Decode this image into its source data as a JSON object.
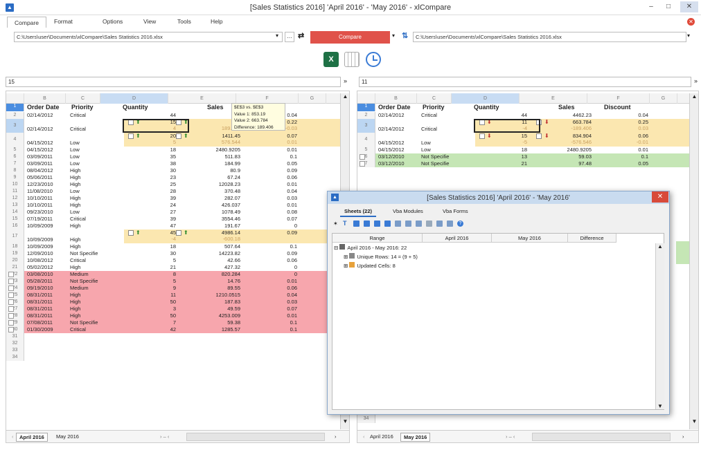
{
  "window": {
    "title": "[Sales Statistics 2016] 'April 2016' - 'May 2016' - xlCompare"
  },
  "menu": [
    "Compare",
    "Format",
    "Options",
    "View",
    "Tools",
    "Help"
  ],
  "paths": {
    "left": "C:\\Users\\user\\Documents\\xlCompare\\Sales Statistics 2016.xlsx",
    "right": "C:\\Users\\user\\Documents\\xlCompare\\Sales Statistics 2016.xlsx"
  },
  "compare_label": "Compare",
  "formula": {
    "left": "15",
    "right": "11"
  },
  "columns": [
    "B",
    "C",
    "D",
    "E",
    "F",
    "G"
  ],
  "header": {
    "order_date": "Order Date",
    "priority": "Priority",
    "quantity": "Quantity",
    "sales": "Sales",
    "discount": "Discount",
    "disc_trunc": "nt"
  },
  "tooltip": [
    "$E$3 vs. $E$3",
    "Value 1: 853.19",
    "Value 2: 663.784",
    "Difference: 189.406"
  ],
  "left_rows": [
    {
      "n": "2",
      "date": "02/14/2012",
      "pri": "Critical",
      "qty": "44",
      "sales": "446",
      "disc": "0.04"
    },
    {
      "n": "3",
      "date": "02/14/2012",
      "pri": "Critical",
      "qty": "15",
      "sub": "4",
      "sales": "85",
      "ssub": "189.406",
      "disc": "0.22",
      "dsub": "-0.03"
    },
    {
      "n": "4",
      "date": "04/15/2012",
      "pri": "Low",
      "qty": "20",
      "sub": "5",
      "sales": "1411.45",
      "ssub": "576.544",
      "disc": "0.07",
      "dsub": "0.01"
    },
    {
      "n": "5",
      "date": "04/15/2012",
      "pri": "Low",
      "qty": "18",
      "sales": "2480.9205",
      "disc": "0.01"
    },
    {
      "n": "6",
      "date": "03/09/2011",
      "pri": "Low",
      "qty": "35",
      "sales": "511.83",
      "disc": "0.1"
    },
    {
      "n": "7",
      "date": "03/09/2011",
      "pri": "Low",
      "qty": "38",
      "sales": "184.99",
      "disc": "0.05"
    },
    {
      "n": "8",
      "date": "08/04/2012",
      "pri": "High",
      "qty": "30",
      "sales": "80.9",
      "disc": "0.09"
    },
    {
      "n": "9",
      "date": "05/06/2011",
      "pri": "High",
      "qty": "23",
      "sales": "67.24",
      "disc": "0.06"
    },
    {
      "n": "10",
      "date": "12/23/2010",
      "pri": "High",
      "qty": "25",
      "sales": "12028.23",
      "disc": "0.01"
    },
    {
      "n": "11",
      "date": "11/08/2010",
      "pri": "Low",
      "qty": "28",
      "sales": "370.48",
      "disc": "0.04"
    },
    {
      "n": "12",
      "date": "10/10/2011",
      "pri": "High",
      "qty": "39",
      "sales": "282.07",
      "disc": "0.03"
    },
    {
      "n": "13",
      "date": "10/10/2011",
      "pri": "High",
      "qty": "24",
      "sales": "426.037",
      "disc": "0.01"
    },
    {
      "n": "14",
      "date": "09/23/2010",
      "pri": "Low",
      "qty": "27",
      "sales": "1078.49",
      "disc": "0.08"
    },
    {
      "n": "15",
      "date": "07/19/2011",
      "pri": "Critical",
      "qty": "39",
      "sales": "3554.46",
      "disc": "0.07"
    },
    {
      "n": "16",
      "date": "10/09/2009",
      "pri": "High",
      "qty": "47",
      "sales": "191.67",
      "disc": "0"
    },
    {
      "n": "17",
      "date": "10/09/2009",
      "pri": "High",
      "qty": "45",
      "sub": "-4",
      "sales": "4986.14",
      "ssub": "-600.18",
      "disc": "0.09"
    },
    {
      "n": "18",
      "date": "10/09/2009",
      "pri": "High",
      "qty": "18",
      "sales": "507.64",
      "disc": "0.1"
    },
    {
      "n": "19",
      "date": "12/09/2010",
      "pri": "Not Specifie",
      "qty": "30",
      "sales": "14223.82",
      "disc": "0.09"
    },
    {
      "n": "20",
      "date": "10/08/2012",
      "pri": "Critical",
      "qty": "5",
      "sales": "42.66",
      "disc": "0.06"
    },
    {
      "n": "21",
      "date": "05/02/2012",
      "pri": "High",
      "qty": "21",
      "sales": "427.32",
      "disc": "0"
    },
    {
      "n": "22",
      "date": "03/08/2010",
      "pri": "Medium",
      "qty": "8",
      "sales": "820.284",
      "disc": "0"
    },
    {
      "n": "23",
      "date": "05/28/2011",
      "pri": "Not Specifie",
      "qty": "5",
      "sales": "14.76",
      "disc": "0.01"
    },
    {
      "n": "24",
      "date": "09/19/2010",
      "pri": "Medium",
      "qty": "9",
      "sales": "89.55",
      "disc": "0.06"
    },
    {
      "n": "25",
      "date": "08/31/2011",
      "pri": "High",
      "qty": "11",
      "sales": "1210.0515",
      "disc": "0.04"
    },
    {
      "n": "26",
      "date": "08/31/2011",
      "pri": "High",
      "qty": "50",
      "sales": "187.83",
      "disc": "0.03"
    },
    {
      "n": "27",
      "date": "08/31/2011",
      "pri": "High",
      "qty": "3",
      "sales": "49.59",
      "disc": "0.07"
    },
    {
      "n": "28",
      "date": "08/31/2011",
      "pri": "High",
      "qty": "50",
      "sales": "4253.009",
      "disc": "0.01"
    },
    {
      "n": "29",
      "date": "07/08/2011",
      "pri": "Not Specifie",
      "qty": "7",
      "sales": "59.38",
      "disc": "0.1"
    },
    {
      "n": "30",
      "date": "01/30/2009",
      "pri": "Critical",
      "qty": "42",
      "sales": "1285.57",
      "disc": "0.1"
    },
    {
      "n": "31"
    },
    {
      "n": "32"
    },
    {
      "n": "33"
    },
    {
      "n": "34"
    }
  ],
  "right_rows": [
    {
      "n": "2",
      "date": "02/14/2012",
      "pri": "Critical",
      "qty": "44",
      "sales": "4462.23",
      "disc": "0.04"
    },
    {
      "n": "3",
      "date": "02/14/2012",
      "pri": "Critical",
      "qty": "11",
      "sub": "-4",
      "sales": "663.784",
      "ssub": "-189.406",
      "disc": "0.25",
      "dsub": "0.03"
    },
    {
      "n": "4",
      "date": "04/15/2012",
      "pri": "Low",
      "qty": "15",
      "sub": "-5",
      "sales": "834.904",
      "ssub": "-576.546",
      "disc": "0.06",
      "dsub": "-0.01"
    },
    {
      "n": "5",
      "date": "04/15/2012",
      "pri": "Low",
      "qty": "18",
      "sales": "2480.9205",
      "disc": "0.01"
    },
    {
      "n": "6",
      "date": "03/12/2010",
      "pri": "Not Specifie",
      "qty": "13",
      "sales": "59.03",
      "disc": "0.1"
    },
    {
      "n": "7",
      "date": "03/12/2010",
      "pri": "Not Specifie",
      "qty": "21",
      "sales": "97.48",
      "disc": "0.05"
    }
  ],
  "right_extra_rows": [
    "33",
    "34"
  ],
  "sheets": {
    "left": [
      "April 2016",
      "May 2016"
    ],
    "right": [
      "April 2016",
      "May 2016"
    ]
  },
  "dialog": {
    "title": "[Sales Statistics 2016] 'April 2016' - 'May 2016'",
    "tabs": [
      "Sheets (22)",
      "Vba Modules",
      "Vba Forms"
    ],
    "columns": [
      "Range",
      "April 2016",
      "May 2016",
      "Difference"
    ],
    "tree": [
      "April 2016 - May 2016: 22",
      "Unique Rows: 14 = (9 + 5)",
      "Updated Cells: 8"
    ]
  },
  "colors": {
    "changed": "#fbe7b0",
    "removed": "#f7a6ad",
    "added": "#c5e6b5",
    "compare": "#e0524a",
    "accent": "#2b6cc4"
  }
}
